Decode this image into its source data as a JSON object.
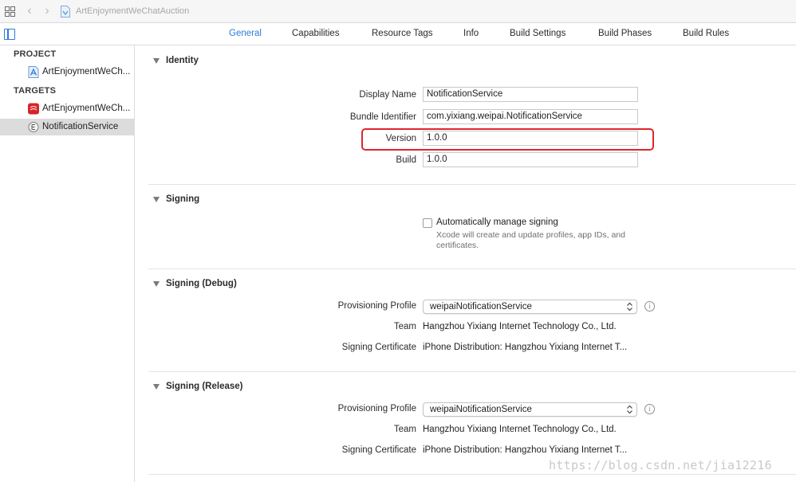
{
  "breadcrumb": {
    "project_name": "ArtEnjoymentWeChatAuction"
  },
  "tabs": [
    {
      "label": "General",
      "active": true
    },
    {
      "label": "Capabilities",
      "active": false
    },
    {
      "label": "Resource Tags",
      "active": false
    },
    {
      "label": "Info",
      "active": false
    },
    {
      "label": "Build Settings",
      "active": false
    },
    {
      "label": "Build Phases",
      "active": false
    },
    {
      "label": "Build Rules",
      "active": false
    }
  ],
  "sidebar": {
    "project_header": "PROJECT",
    "project_items": [
      {
        "label": "ArtEnjoymentWeCh...",
        "icon": "xcode-project-icon"
      }
    ],
    "targets_header": "TARGETS",
    "target_items": [
      {
        "label": "ArtEnjoymentWeCh...",
        "icon": "app-target-icon",
        "selected": false
      },
      {
        "label": "NotificationService",
        "icon": "extension-target-icon",
        "selected": true
      }
    ]
  },
  "identity": {
    "title": "Identity",
    "display_name_label": "Display Name",
    "display_name_value": "NotificationService",
    "bundle_id_label": "Bundle Identifier",
    "bundle_id_value": "com.yixiang.weipai.NotificationService",
    "version_label": "Version",
    "version_value": "1.0.0",
    "build_label": "Build",
    "build_value": "1.0.0"
  },
  "signing": {
    "title": "Signing",
    "auto_manage_label": "Automatically manage signing",
    "auto_manage_checked": false,
    "auto_manage_desc": "Xcode will create and update profiles, app IDs, and certificates."
  },
  "signing_debug": {
    "title": "Signing (Debug)",
    "profile_label": "Provisioning Profile",
    "profile_value": "weipaiNotificationService",
    "team_label": "Team",
    "team_value": "Hangzhou Yixiang Internet Technology Co., Ltd.",
    "cert_label": "Signing Certificate",
    "cert_value": "iPhone Distribution: Hangzhou Yixiang Internet T..."
  },
  "signing_release": {
    "title": "Signing (Release)",
    "profile_label": "Provisioning Profile",
    "profile_value": "weipaiNotificationService",
    "team_label": "Team",
    "team_value": "Hangzhou Yixiang Internet Technology Co., Ltd.",
    "cert_label": "Signing Certificate",
    "cert_value": "iPhone Distribution: Hangzhou Yixiang Internet T..."
  },
  "watermark": "https://blog.csdn.net/jia12216",
  "colors": {
    "accent": "#2f7ad8",
    "highlight": "#e0262b",
    "selection": "#dcdcdc"
  }
}
